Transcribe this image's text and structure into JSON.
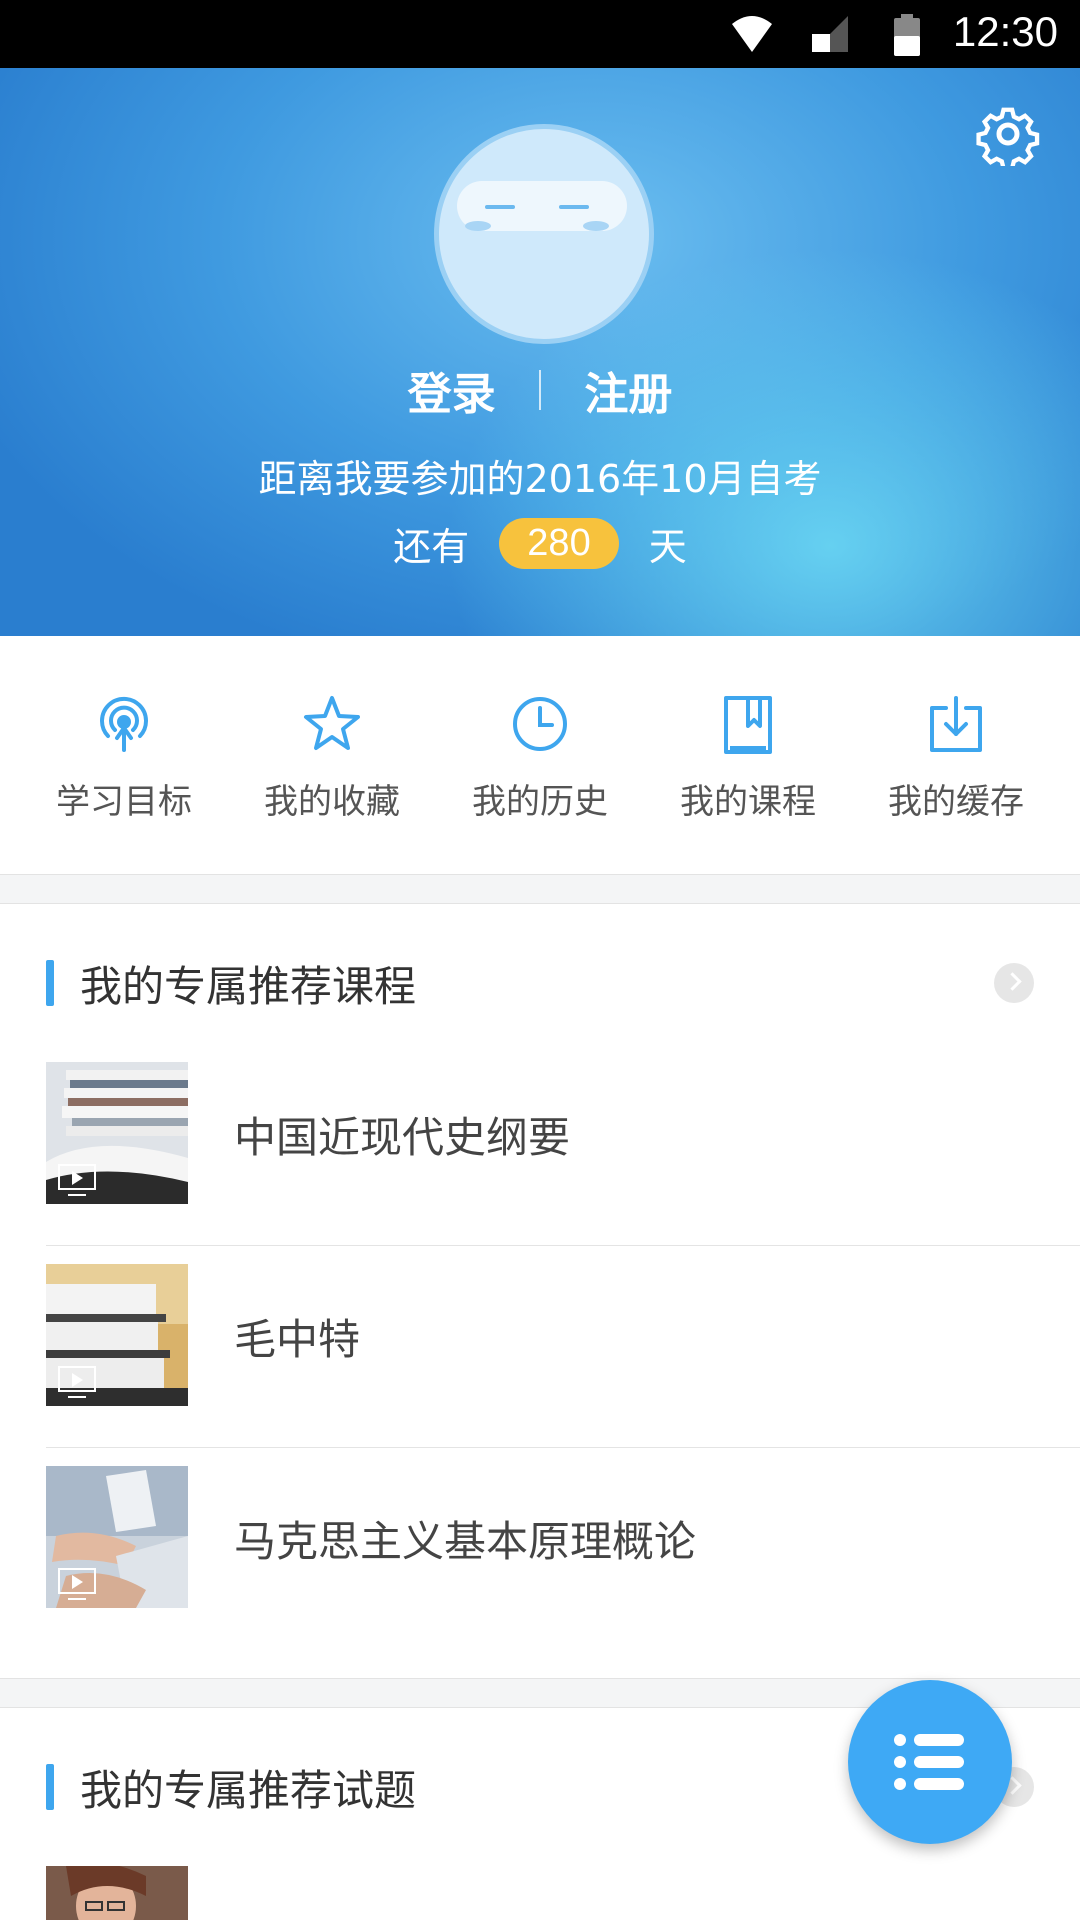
{
  "status_bar": {
    "time": "12:30"
  },
  "header": {
    "login_label": "登录",
    "register_label": "注册",
    "countdown_prefix": "距离我要参加的2016年10月自考",
    "countdown_remain": "还有",
    "countdown_days": "280",
    "countdown_unit": "天",
    "settings_icon": "gear-icon",
    "colors": {
      "gradient_start": "#1f6fc6",
      "gradient_end": "#66d3f3",
      "badge": "#f7c23d"
    }
  },
  "quick_nav": [
    {
      "label": "学习目标",
      "icon": "broadcast-icon"
    },
    {
      "label": "我的收藏",
      "icon": "star-icon"
    },
    {
      "label": "我的历史",
      "icon": "clock-icon"
    },
    {
      "label": "我的课程",
      "icon": "bookmark-book-icon"
    },
    {
      "label": "我的缓存",
      "icon": "download-icon"
    }
  ],
  "recommended_courses": {
    "title": "我的专属推荐课程",
    "items": [
      {
        "title": "中国近现代史纲要"
      },
      {
        "title": "毛中特"
      },
      {
        "title": "马克思主义基本原理概论"
      }
    ]
  },
  "recommended_questions": {
    "title": "我的专属推荐试题"
  },
  "accent_color": "#3ea6ee"
}
